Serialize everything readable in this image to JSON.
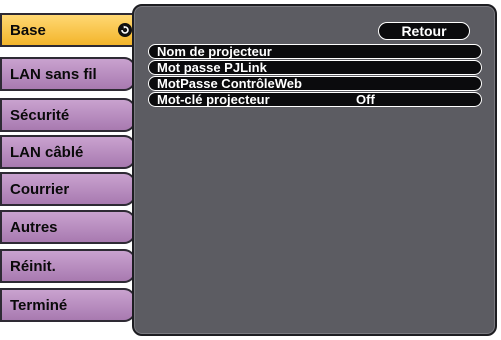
{
  "sidebar": {
    "items": [
      {
        "label": "Base",
        "active": true
      },
      {
        "label": "LAN sans fil",
        "active": false
      },
      {
        "label": "Sécurité",
        "active": false
      },
      {
        "label": "LAN câblé",
        "active": false
      },
      {
        "label": "Courrier",
        "active": false
      },
      {
        "label": "Autres",
        "active": false
      },
      {
        "label": "Réinit.",
        "active": false
      },
      {
        "label": "Terminé",
        "active": false
      }
    ]
  },
  "panel": {
    "back_label": "Retour",
    "rows": [
      {
        "label": "Nom de projecteur",
        "value": ""
      },
      {
        "label": "Mot passe PJLink",
        "value": ""
      },
      {
        "label": "MotPasse ContrôleWeb",
        "value": ""
      },
      {
        "label": "Mot-clé projecteur",
        "value": "Off"
      }
    ]
  },
  "icons": {
    "active_tab_marker": "circle-arrow-icon"
  },
  "colors": {
    "active_tab": "#f5bb33",
    "inactive_tab": "#b98bc0",
    "panel_bg": "#5c5c62",
    "row_bg": "#0b0b0d",
    "text_light": "#ffffff"
  }
}
